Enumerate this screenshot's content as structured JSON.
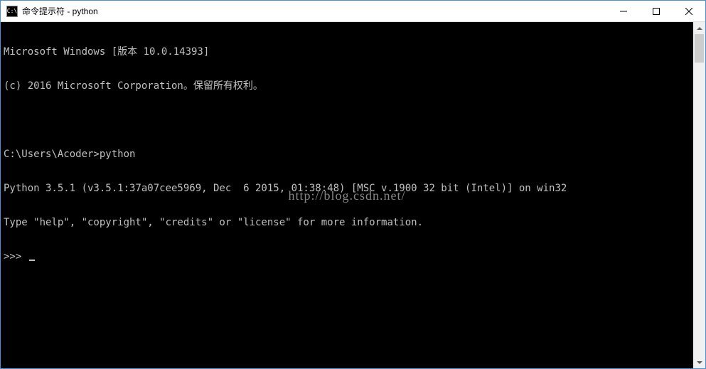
{
  "titlebar": {
    "icon_text": "C:\\",
    "title": "命令提示符 - python"
  },
  "terminal": {
    "line1": "Microsoft Windows [版本 10.0.14393]",
    "line2": "(c) 2016 Microsoft Corporation。保留所有权利。",
    "blank1": "",
    "line3": "C:\\Users\\Acoder>python",
    "line4": "Python 3.5.1 (v3.5.1:37a07cee5969, Dec  6 2015, 01:38:48) [MSC v.1900 32 bit (Intel)] on win32",
    "line5": "Type \"help\", \"copyright\", \"credits\" or \"license\" for more information.",
    "prompt": ">>> "
  },
  "watermark": "http://blog.csdn.net/"
}
